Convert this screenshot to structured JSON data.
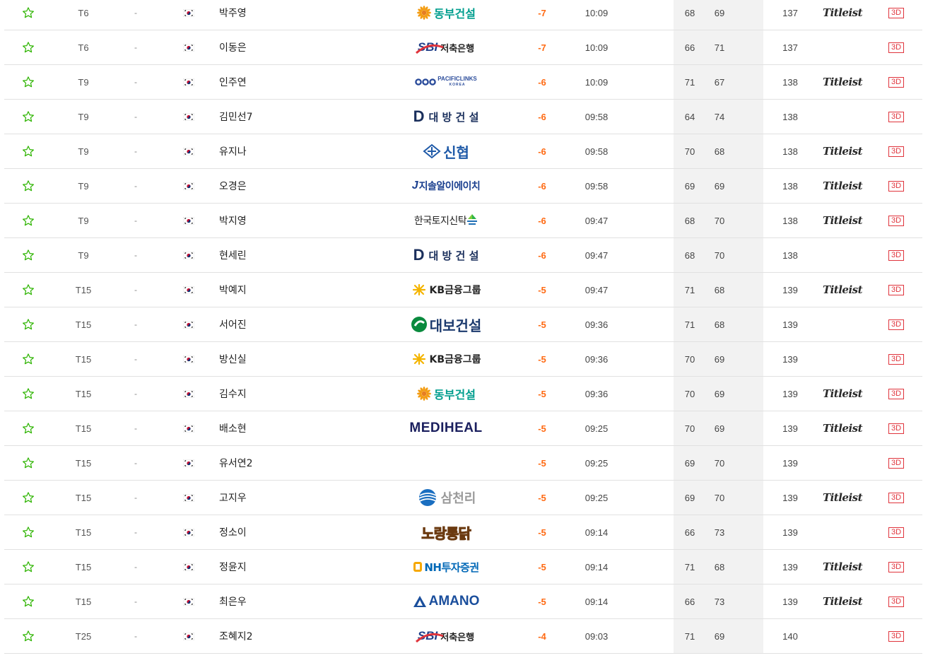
{
  "columns": {
    "favorite_icon": "star-outline-icon",
    "nation_icon": "korea-flag-icon",
    "ball_icon": "titleist-logo",
    "video_label": "3D"
  },
  "colors": {
    "star": "#2db400",
    "score": "#ff6a13",
    "video": "#e0343c",
    "highlight_column": "#f2f2f2"
  },
  "sponsors": {
    "dongbu": {
      "name": "동부건설",
      "color": "#009e8e"
    },
    "sbi": {
      "mark": "SBI",
      "name": "저축은행"
    },
    "pacific": {
      "name": "PACIFICLINKS",
      "sub": "KOREA"
    },
    "daebang": {
      "mark": "D",
      "name": "대 방 건 설"
    },
    "shinhyup": {
      "name": "신협"
    },
    "jisol": {
      "mark": "J",
      "name": "지솔알이에이치"
    },
    "koreatoji": {
      "name": "한국토지신탁"
    },
    "kb": {
      "name": "KB금융그룹"
    },
    "daebo": {
      "name": "대보건설"
    },
    "mediheal": {
      "name": "MEDIHEAL"
    },
    "samchully": {
      "name": "삼천리"
    },
    "norang": {
      "name": "노랑통닭"
    },
    "nh": {
      "name": "NH투자증권"
    },
    "amano": {
      "name": "AMANO"
    }
  },
  "players": [
    {
      "rank": "T6",
      "move": "-",
      "name": "박주영",
      "sponsor": "dongbu",
      "score": "-7",
      "time": "10:09",
      "r1": "68",
      "r2": "69",
      "total": "137",
      "ball": "Titleist",
      "video": "3D"
    },
    {
      "rank": "T6",
      "move": "-",
      "name": "이동은",
      "sponsor": "sbi",
      "score": "-7",
      "time": "10:09",
      "r1": "66",
      "r2": "71",
      "total": "137",
      "ball": "",
      "video": "3D"
    },
    {
      "rank": "T9",
      "move": "-",
      "name": "인주연",
      "sponsor": "pacific",
      "score": "-6",
      "time": "10:09",
      "r1": "71",
      "r2": "67",
      "total": "138",
      "ball": "Titleist",
      "video": "3D"
    },
    {
      "rank": "T9",
      "move": "-",
      "name": "김민선7",
      "sponsor": "daebang",
      "score": "-6",
      "time": "09:58",
      "r1": "64",
      "r2": "74",
      "total": "138",
      "ball": "",
      "video": "3D"
    },
    {
      "rank": "T9",
      "move": "-",
      "name": "유지나",
      "sponsor": "shinhyup",
      "score": "-6",
      "time": "09:58",
      "r1": "70",
      "r2": "68",
      "total": "138",
      "ball": "Titleist",
      "video": "3D"
    },
    {
      "rank": "T9",
      "move": "-",
      "name": "오경은",
      "sponsor": "jisol",
      "score": "-6",
      "time": "09:58",
      "r1": "69",
      "r2": "69",
      "total": "138",
      "ball": "Titleist",
      "video": "3D"
    },
    {
      "rank": "T9",
      "move": "-",
      "name": "박지영",
      "sponsor": "koreatoji",
      "score": "-6",
      "time": "09:47",
      "r1": "68",
      "r2": "70",
      "total": "138",
      "ball": "Titleist",
      "video": "3D"
    },
    {
      "rank": "T9",
      "move": "-",
      "name": "현세린",
      "sponsor": "daebang",
      "score": "-6",
      "time": "09:47",
      "r1": "68",
      "r2": "70",
      "total": "138",
      "ball": "",
      "video": "3D"
    },
    {
      "rank": "T15",
      "move": "-",
      "name": "박예지",
      "sponsor": "kb",
      "score": "-5",
      "time": "09:47",
      "r1": "71",
      "r2": "68",
      "total": "139",
      "ball": "Titleist",
      "video": "3D"
    },
    {
      "rank": "T15",
      "move": "-",
      "name": "서어진",
      "sponsor": "daebo",
      "score": "-5",
      "time": "09:36",
      "r1": "71",
      "r2": "68",
      "total": "139",
      "ball": "",
      "video": "3D"
    },
    {
      "rank": "T15",
      "move": "-",
      "name": "방신실",
      "sponsor": "kb",
      "score": "-5",
      "time": "09:36",
      "r1": "70",
      "r2": "69",
      "total": "139",
      "ball": "",
      "video": "3D"
    },
    {
      "rank": "T15",
      "move": "-",
      "name": "김수지",
      "sponsor": "dongbu",
      "score": "-5",
      "time": "09:36",
      "r1": "70",
      "r2": "69",
      "total": "139",
      "ball": "Titleist",
      "video": "3D"
    },
    {
      "rank": "T15",
      "move": "-",
      "name": "배소현",
      "sponsor": "mediheal",
      "score": "-5",
      "time": "09:25",
      "r1": "70",
      "r2": "69",
      "total": "139",
      "ball": "Titleist",
      "video": "3D"
    },
    {
      "rank": "T15",
      "move": "-",
      "name": "유서연2",
      "sponsor": "",
      "score": "-5",
      "time": "09:25",
      "r1": "69",
      "r2": "70",
      "total": "139",
      "ball": "",
      "video": "3D"
    },
    {
      "rank": "T15",
      "move": "-",
      "name": "고지우",
      "sponsor": "samchully",
      "score": "-5",
      "time": "09:25",
      "r1": "69",
      "r2": "70",
      "total": "139",
      "ball": "Titleist",
      "video": "3D"
    },
    {
      "rank": "T15",
      "move": "-",
      "name": "정소이",
      "sponsor": "norang",
      "score": "-5",
      "time": "09:14",
      "r1": "66",
      "r2": "73",
      "total": "139",
      "ball": "",
      "video": "3D"
    },
    {
      "rank": "T15",
      "move": "-",
      "name": "정윤지",
      "sponsor": "nh",
      "score": "-5",
      "time": "09:14",
      "r1": "71",
      "r2": "68",
      "total": "139",
      "ball": "Titleist",
      "video": "3D"
    },
    {
      "rank": "T15",
      "move": "-",
      "name": "최은우",
      "sponsor": "amano",
      "score": "-5",
      "time": "09:14",
      "r1": "66",
      "r2": "73",
      "total": "139",
      "ball": "Titleist",
      "video": "3D"
    },
    {
      "rank": "T25",
      "move": "-",
      "name": "조혜지2",
      "sponsor": "sbi",
      "score": "-4",
      "time": "09:03",
      "r1": "71",
      "r2": "69",
      "total": "140",
      "ball": "",
      "video": "3D"
    }
  ]
}
